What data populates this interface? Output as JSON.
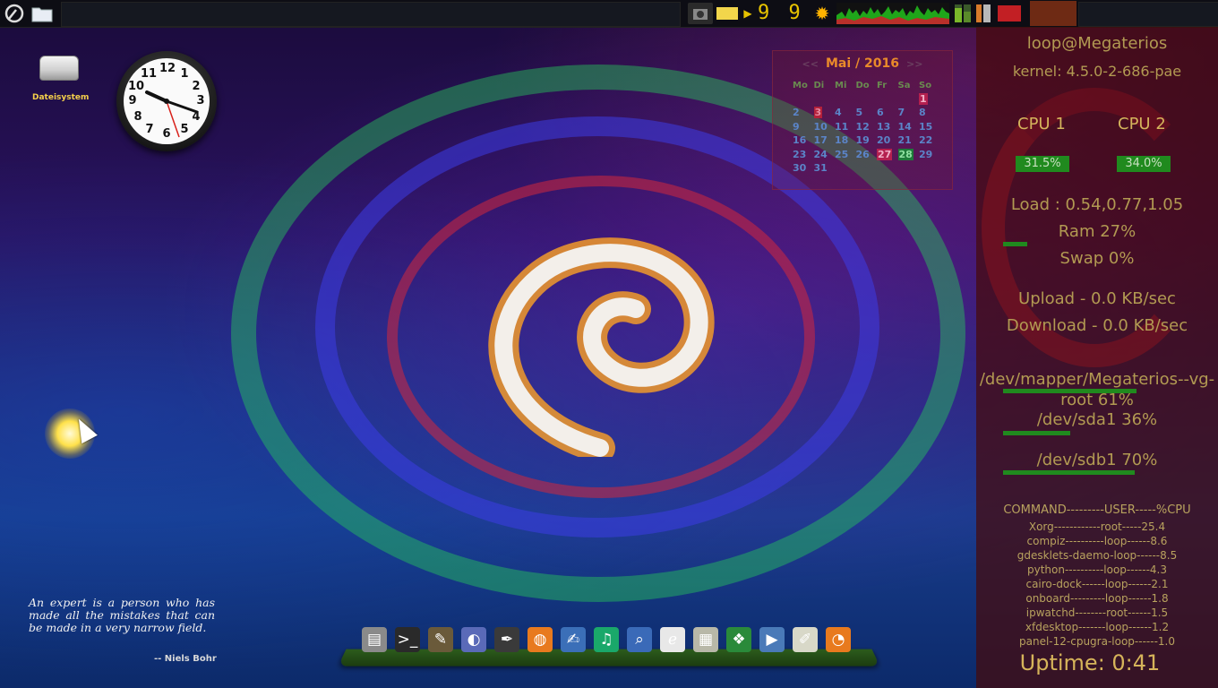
{
  "top_panel": {
    "clock_digits": "9 9",
    "launcher_icons": [
      "logo-icon",
      "folder-icon"
    ],
    "tray_icons": [
      "camera-icon",
      "notes-icon",
      "play-icon",
      "weather-sun-icon",
      "cpu-graph-icon",
      "meter-bars-icon",
      "tray-app-icon"
    ],
    "active_task_color": "#6e2a14"
  },
  "desktop": {
    "icon_label": "Dateisystem",
    "quote": "An expert is a person who has made all the mistakes that can be made in a very narrow field.",
    "quote_author": "-- Niels Bohr"
  },
  "clock": {
    "numbers": [
      "12",
      "1",
      "2",
      "3",
      "4",
      "5",
      "6",
      "7",
      "8",
      "9",
      "10",
      "11"
    ]
  },
  "calendar": {
    "month": "Mai / 2016",
    "prev": "<<",
    "next": ">>",
    "weekdays": [
      "Mo",
      "Di",
      "Mi",
      "Do",
      "Fr",
      "Sa",
      "So"
    ],
    "weeks": [
      [
        "",
        "",
        "",
        "",
        "",
        "",
        "1"
      ],
      [
        "2",
        "3",
        "4",
        "5",
        "6",
        "7",
        "8"
      ],
      [
        "9",
        "10",
        "11",
        "12",
        "13",
        "14",
        "15"
      ],
      [
        "16",
        "17",
        "18",
        "19",
        "20",
        "21",
        "22"
      ],
      [
        "23",
        "24",
        "25",
        "26",
        "27",
        "28",
        "29"
      ],
      [
        "30",
        "31",
        "",
        "",
        "",
        "",
        ""
      ]
    ],
    "highlighted": {
      "1": "hl-pink",
      "3": "hl-red",
      "27": "hl-pink",
      "28": "hl-green"
    }
  },
  "conky": {
    "host": "loop@Megaterios",
    "kernel": "kernel: 4.5.0-2-686-pae",
    "cpu1_label": "CPU 1",
    "cpu2_label": "CPU 2",
    "cpu1_value": "31.5%",
    "cpu2_value": "34.0%",
    "cpu1_percent": 31.5,
    "cpu2_percent": 34.0,
    "load": "Load : 0.54,0.77,1.05",
    "ram": "Ram 27%",
    "ram_percent": 27,
    "swap": "Swap 0%",
    "upload": "Upload - 0.0 KB/sec",
    "download": "Download - 0.0 KB/sec",
    "disk1_a": "/dev/mapper/Megaterios--vg-",
    "disk1_b": "root 61%",
    "disk1_percent": 61,
    "disk2": "/dev/sda1 36%",
    "disk2_percent": 36,
    "disk3": "/dev/sdb1 70%",
    "disk3_percent": 70,
    "process_header": "COMMAND---------USER-----%CPU",
    "processes": [
      "Xorg------------root-----25.4",
      "compiz----------loop------8.6",
      "gdesklets-daemo-loop------8.5",
      "python----------loop------4.3",
      "cairo-dock------loop------2.1",
      "onboard---------loop------1.8",
      "ipwatchd--------root------1.5",
      "xfdesktop-------loop------1.2",
      "panel-12-cpugra-loop------1.0"
    ],
    "uptime": "Uptime: 0:41"
  },
  "dock": {
    "apps": [
      {
        "name": "file-manager-icon",
        "glyph": "▤",
        "color": "#8a8a8a"
      },
      {
        "name": "terminal-icon",
        "glyph": ">_",
        "color": "#2a2a2a"
      },
      {
        "name": "gimp-icon",
        "glyph": "✎",
        "color": "#6a5a3a"
      },
      {
        "name": "web-browser-icon",
        "glyph": "◐",
        "color": "#5a6ab8"
      },
      {
        "name": "inkscape-icon",
        "glyph": "✒",
        "color": "#3a3a3a"
      },
      {
        "name": "blender-icon",
        "glyph": "◍",
        "color": "#e87a1e"
      },
      {
        "name": "editor-icon",
        "glyph": "✍",
        "color": "#3b6fb8"
      },
      {
        "name": "headphones-icon",
        "glyph": "♫",
        "color": "#1aa86a"
      },
      {
        "name": "search-icon",
        "glyph": "⌕",
        "color": "#3a6ab8"
      },
      {
        "name": "pdf-reader-icon",
        "glyph": "ℯ",
        "color": "#e8e8e8"
      },
      {
        "name": "office-icon",
        "glyph": "▦",
        "color": "#b8b8a8"
      },
      {
        "name": "windows-app-icon",
        "glyph": "❖",
        "color": "#2a8a3a"
      },
      {
        "name": "media-player-icon",
        "glyph": "▶",
        "color": "#4a7ab8"
      },
      {
        "name": "text-editor-icon",
        "glyph": "✐",
        "color": "#d8d8c8"
      },
      {
        "name": "rss-icon",
        "glyph": "◔",
        "color": "#e87a1e"
      }
    ]
  }
}
